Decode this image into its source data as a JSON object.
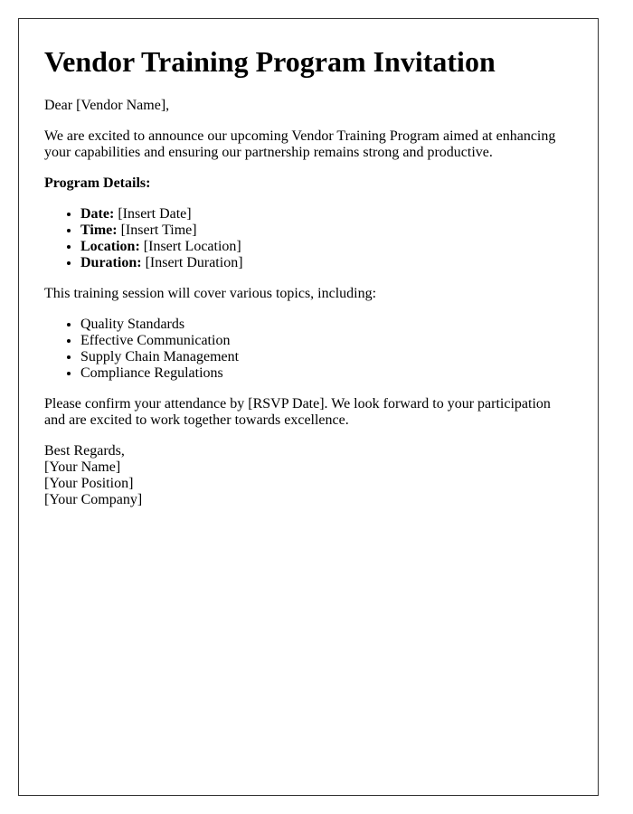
{
  "letter": {
    "title": "Vendor Training Program Invitation",
    "salutation": "Dear [Vendor Name],",
    "intro": "We are excited to announce our upcoming Vendor Training Program aimed at enhancing your capabilities and ensuring our partnership remains strong and productive.",
    "details_heading": "Program Details:",
    "details": [
      {
        "label": "Date:",
        "value": "[Insert Date]"
      },
      {
        "label": "Time:",
        "value": "[Insert Time]"
      },
      {
        "label": "Location:",
        "value": "[Insert Location]"
      },
      {
        "label": "Duration:",
        "value": "[Insert Duration]"
      }
    ],
    "topics_intro": "This training session will cover various topics, including:",
    "topics": [
      "Quality Standards",
      "Effective Communication",
      "Supply Chain Management",
      "Compliance Regulations"
    ],
    "closing_paragraph": "Please confirm your attendance by [RSVP Date]. We look forward to your participation and are excited to work together towards excellence.",
    "signature": {
      "closing": "Best Regards,",
      "name": "[Your Name]",
      "position": "[Your Position]",
      "company": "[Your Company]"
    }
  }
}
